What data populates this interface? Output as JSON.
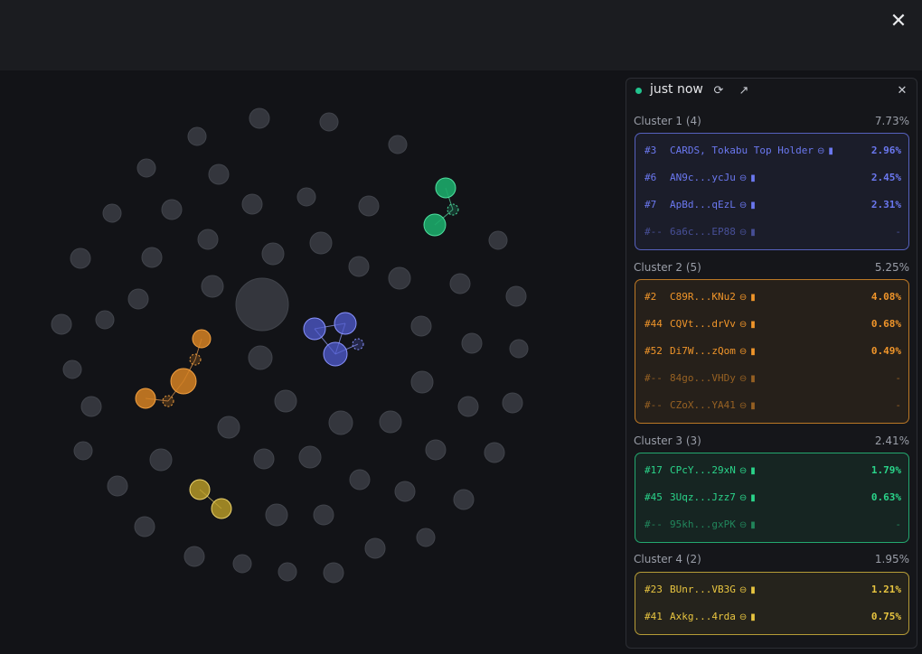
{
  "window": {
    "close_icon": "close-icon"
  },
  "panel": {
    "status_text": "just now",
    "status_color": "#22c38e",
    "refresh_icon": "refresh-icon",
    "external_icon": "external-link-icon",
    "close_icon": "close-icon"
  },
  "clusters": [
    {
      "title": "Cluster 1 (4)",
      "total": "7.73%",
      "color": "#6b78f0",
      "rows": [
        {
          "rank": "#3",
          "label": "CARDS, Tokabu Top Holder",
          "value": "2.96%"
        },
        {
          "rank": "#6",
          "label": "AN9c...ycJu",
          "value": "2.45%"
        },
        {
          "rank": "#7",
          "label": "ApBd...qEzL",
          "value": "2.31%"
        },
        {
          "rank": "#--",
          "label": "6a6c...EP88",
          "value": "-"
        }
      ]
    },
    {
      "title": "Cluster 2 (5)",
      "total": "5.25%",
      "color": "#f0952a",
      "rows": [
        {
          "rank": "#2",
          "label": "C89R...KNu2",
          "value": "4.08%"
        },
        {
          "rank": "#44",
          "label": "CQVt...drVv",
          "value": "0.68%"
        },
        {
          "rank": "#52",
          "label": "Di7W...zQom",
          "value": "0.49%"
        },
        {
          "rank": "#--",
          "label": "84go...VHDy",
          "value": "-"
        },
        {
          "rank": "#--",
          "label": "CZoX...YA41",
          "value": "-"
        }
      ]
    },
    {
      "title": "Cluster 3 (3)",
      "total": "2.41%",
      "color": "#2ad48a",
      "rows": [
        {
          "rank": "#17",
          "label": "CPcY...29xN",
          "value": "1.79%"
        },
        {
          "rank": "#45",
          "label": "3Uqz...Jzz7",
          "value": "0.63%"
        },
        {
          "rank": "#--",
          "label": "95kh...gxPK",
          "value": "-"
        }
      ]
    },
    {
      "title": "Cluster 4 (2)",
      "total": "1.95%",
      "color": "#e8c540",
      "rows": [
        {
          "rank": "#23",
          "label": "BUnr...VB3G",
          "value": "1.21%"
        },
        {
          "rank": "#41",
          "label": "Axkg...4rda",
          "value": "0.75%"
        }
      ]
    }
  ],
  "row_icons": [
    "link-icon",
    "copy-icon"
  ]
}
